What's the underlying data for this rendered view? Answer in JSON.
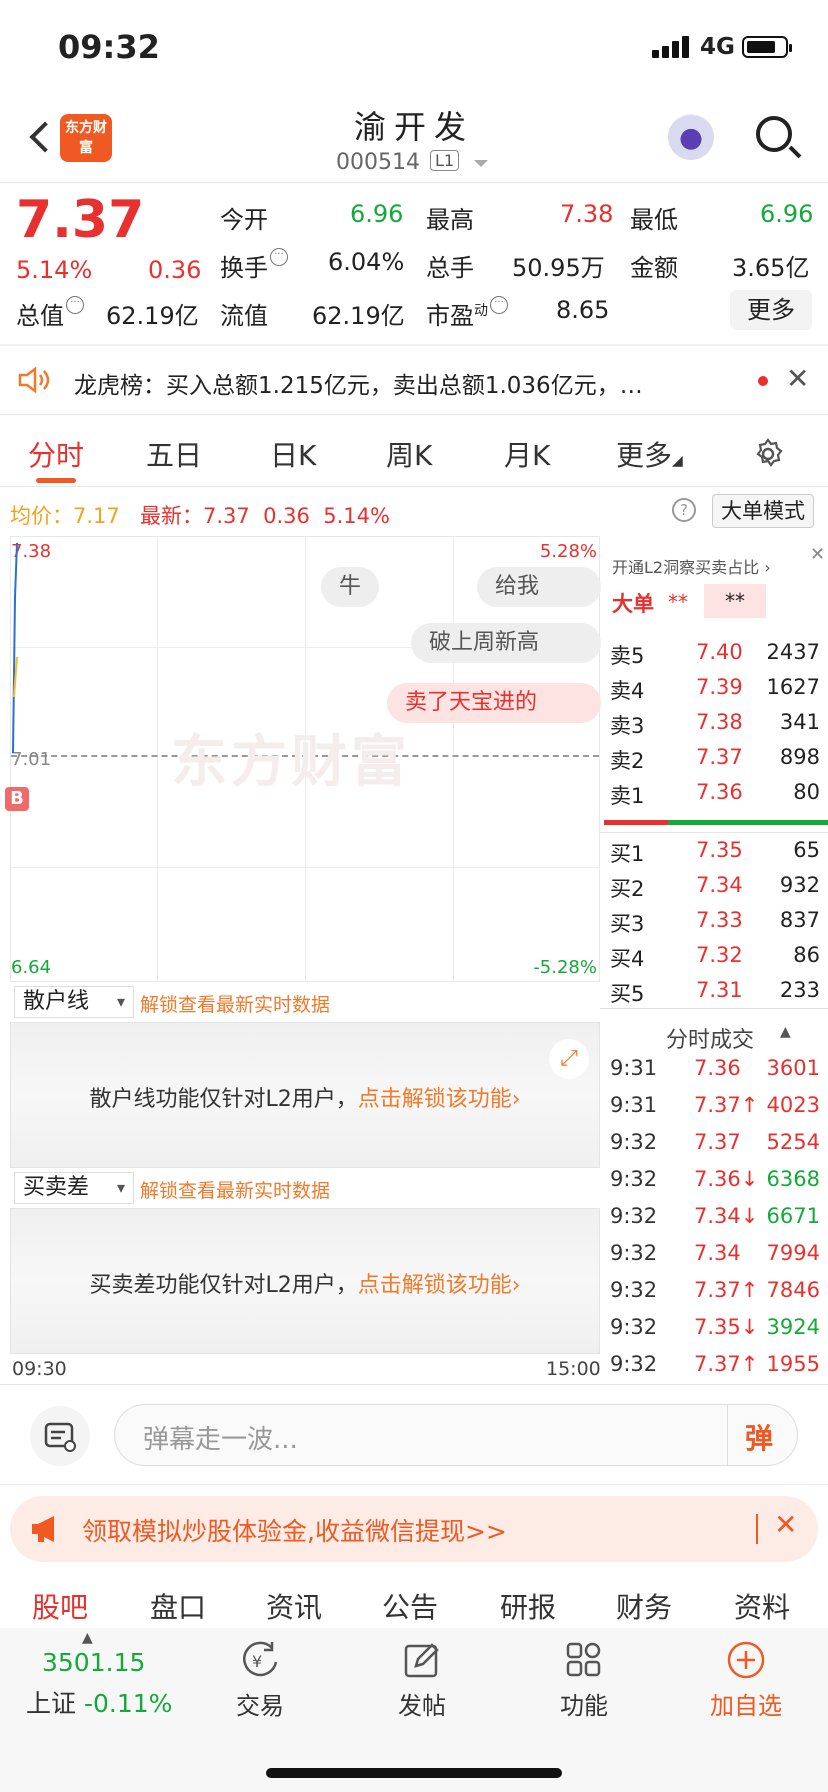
{
  "status": {
    "time": "09:32",
    "network": "4G"
  },
  "header": {
    "logo": "东方财富",
    "title": "渝开发",
    "code": "000514",
    "level": "L1"
  },
  "quote": {
    "price": "7.37",
    "change_pct": "5.14%",
    "change": "0.36",
    "open_label": "今开",
    "open": "6.96",
    "high_label": "最高",
    "high": "7.38",
    "low_label": "最低",
    "low": "6.96",
    "turnover_label": "换手",
    "turnover": "6.04%",
    "volume_label": "总手",
    "volume": "50.95万",
    "amount_label": "金额",
    "amount": "3.65亿",
    "mcap_label": "总值",
    "mcap": "62.19亿",
    "float_label": "流值",
    "float": "62.19亿",
    "pe_label": "市盈",
    "pe_sup": "动",
    "pe": "8.65",
    "more": "更多"
  },
  "notice": {
    "text": "龙虎榜：买入总额1.215亿元，卖出总额1.036亿元，…"
  },
  "tabs": [
    "分时",
    "五日",
    "日K",
    "周K",
    "月K",
    "更多"
  ],
  "avg_bar": {
    "avg_label": "均价：",
    "avg": "7.17",
    "latest_label": "最新：",
    "latest": "7.37",
    "chg": "0.36",
    "pct": "5.14%",
    "big_mode": "大单模式",
    "help": "?"
  },
  "chart": {
    "y_top": "7.38",
    "y_mid": "7.01",
    "y_bot": "6.64",
    "pct_top": "5.28%",
    "pct_bot": "-5.28%",
    "t_start": "09:30",
    "t_end": "15:00",
    "watermark": "东方财富",
    "b_marker": "B",
    "bubbles": [
      "牛",
      "给我",
      "破上周新高",
      "卖了天宝进的"
    ]
  },
  "orderbook": {
    "promo": "开通L2洞察买卖占比",
    "big_label": "大单",
    "big_a": "**",
    "big_b": "**",
    "sell": [
      {
        "n": "卖5",
        "p": "7.40",
        "v": "2437"
      },
      {
        "n": "卖4",
        "p": "7.39",
        "v": "1627"
      },
      {
        "n": "卖3",
        "p": "7.38",
        "v": "341"
      },
      {
        "n": "卖2",
        "p": "7.37",
        "v": "898"
      },
      {
        "n": "卖1",
        "p": "7.36",
        "v": "80"
      }
    ],
    "buy": [
      {
        "n": "买1",
        "p": "7.35",
        "v": "65"
      },
      {
        "n": "买2",
        "p": "7.34",
        "v": "932"
      },
      {
        "n": "买3",
        "p": "7.33",
        "v": "837"
      },
      {
        "n": "买4",
        "p": "7.32",
        "v": "86"
      },
      {
        "n": "买5",
        "p": "7.31",
        "v": "233"
      }
    ]
  },
  "ticks": {
    "title": "分时成交",
    "rows": [
      {
        "t": "9:31",
        "p": "7.36",
        "v": "3601"
      },
      {
        "t": "9:31",
        "p": "7.37↑",
        "v": "4023"
      },
      {
        "t": "9:32",
        "p": "7.37",
        "v": "5254"
      },
      {
        "t": "9:32",
        "p": "7.36↓",
        "v": "6368"
      },
      {
        "t": "9:32",
        "p": "7.34↓",
        "v": "6671"
      },
      {
        "t": "9:32",
        "p": "7.34",
        "v": "7994"
      },
      {
        "t": "9:32",
        "p": "7.37↑",
        "v": "7846"
      },
      {
        "t": "9:32",
        "p": "7.35↓",
        "v": "3924"
      },
      {
        "t": "9:32",
        "p": "7.37↑",
        "v": "1955"
      }
    ]
  },
  "panels": {
    "retail_label": "散户线",
    "retail_unlock": "解锁查看最新实时数据",
    "retail_msg": "散户线功能仅针对L2用户，",
    "retail_link": "点击解锁该功能",
    "spread_label": "买卖差",
    "spread_unlock": "解锁查看最新实时数据",
    "spread_msg": "买卖差功能仅针对L2用户，",
    "spread_link": "点击解锁该功能"
  },
  "danmu": {
    "placeholder": "弹幕走一波...",
    "send": "弹"
  },
  "promo": {
    "text": "领取模拟炒股体验金,收益微信提现>>"
  },
  "subtabs": [
    "股吧",
    "盘口",
    "资讯",
    "公告",
    "研报",
    "财务",
    "资料"
  ],
  "bottom": {
    "index_value": "3501.15",
    "index_name": "上证",
    "index_chg": "-0.11%",
    "trade": "交易",
    "post": "发帖",
    "func": "功能",
    "add": "加自选"
  }
}
